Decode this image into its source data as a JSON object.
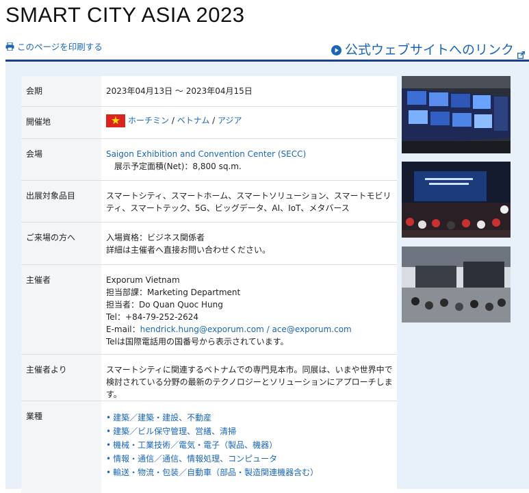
{
  "title": "SMART CITY ASIA 2023",
  "print_link": "このページを印刷する",
  "official_link": "公式ウェブサイトへのリンク",
  "rows": {
    "period": {
      "label": "会期",
      "value": "2023年04月13日 〜 2023年04月15日"
    },
    "location": {
      "label": "開催地",
      "city": "ホーチミン",
      "sep1": " / ",
      "country": "ベトナム",
      "sep2": " / ",
      "region": "アジア"
    },
    "venue": {
      "label": "会場",
      "name": "Saigon Exhibition and Convention Center (SECC)",
      "area": "展示予定面積(Net)：8,800 sq.m."
    },
    "items": {
      "label": "出展対象品目",
      "value": "スマートシティ、スマートホーム、スマートソリューション、スマートモビリティ、スマートテック、5G、ビッグデータ、AI、IoT、メタバース"
    },
    "visitors": {
      "label": "ご来場の方へ",
      "line1": "入場資格：ビジネス関係者",
      "line2": "詳細は主催者へ直接お問い合わせください。"
    },
    "organizer": {
      "label": "主催者",
      "name": "Exporum Vietnam",
      "dept": "担当部課：Marketing Department",
      "person": "担当者：Do Quan Quoc Hung",
      "tel": "Tel：+84-79-252-2624",
      "email_label": "E-mail：",
      "email1": "hendrick.hung@exporum.com",
      "email_sep": " / ",
      "email2": "ace@exporum.com",
      "note": "Telは国際電話用の国番号から表示されています。"
    },
    "message": {
      "label": "主催者より",
      "value": "スマートシティに関連するベトナムでの専門見本市。同展は、いまや世界中で検討されている分野の最新のテクノロジーとソリューションにアプローチします。"
    },
    "industry": {
      "label": "業種",
      "items": [
        "建築／建築・建設、不動産",
        "建築／ビル保守管理、営繕、清掃",
        "機械・工業技術／電気・電子（製品、機器）",
        "情報・通信／通信、情報処理、コンピュータ",
        "輸送・物流・包装／自動車（部品・製造関連機器含む）"
      ]
    }
  },
  "colors": {
    "link": "#1a66b5",
    "rule": "#1b3f93",
    "panel": "#e8f1fa",
    "flag_red": "#da251d",
    "flag_star": "#ffde00"
  }
}
